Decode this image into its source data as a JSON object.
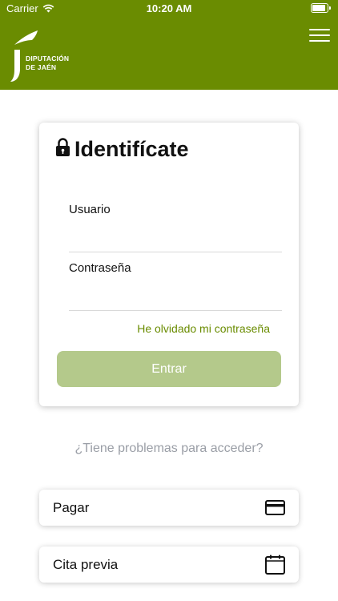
{
  "status_bar": {
    "carrier": "Carrier",
    "time": "10:20 AM",
    "wifi_icon": "wifi-icon",
    "battery_icon": "battery-icon"
  },
  "header": {
    "background_color": "#6a8c01",
    "logo_line1": "DIPUTACIÓN",
    "logo_line2": "DE JAÉN",
    "menu_icon": "hamburger-menu-icon"
  },
  "login": {
    "title": "Identifícate",
    "title_icon": "lock-icon",
    "username_label": "Usuario",
    "username_value": "",
    "password_label": "Contraseña",
    "password_value": "",
    "forgot_password": "He olvidado mi contraseña",
    "submit_label": "Entrar",
    "submit_color": "#b4c98b",
    "link_color": "#6a8c01"
  },
  "help": {
    "text": "¿Tiene problemas para acceder?"
  },
  "actions": [
    {
      "label": "Pagar",
      "icon": "credit-card-icon"
    },
    {
      "label": "Cita previa",
      "icon": "calendar-icon"
    }
  ]
}
